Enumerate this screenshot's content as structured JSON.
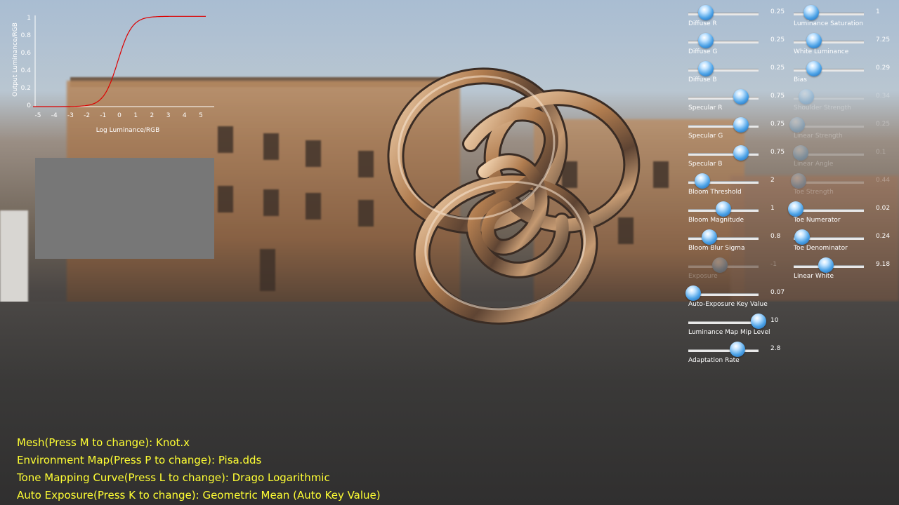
{
  "graph": {
    "ylabel": "Output Luminance/RGB",
    "xlabel": "Log Luminance/RGB",
    "y_ticks": [
      "1",
      "0.8",
      "0.6",
      "0.4",
      "0.2",
      "0"
    ],
    "x_ticks": [
      "-5",
      "-4",
      "-3",
      "-2",
      "-1",
      "0",
      "1",
      "2",
      "3",
      "4",
      "5"
    ],
    "curve_color": "#dd0000"
  },
  "sliders_left": [
    {
      "label": "Diffuse R",
      "value": "0.25",
      "level": 0.25,
      "enabled": true
    },
    {
      "label": "Diffuse G",
      "value": "0.25",
      "level": 0.25,
      "enabled": true
    },
    {
      "label": "Diffuse B",
      "value": "0.25",
      "level": 0.25,
      "enabled": true
    },
    {
      "label": "Specular R",
      "value": "0.75",
      "level": 0.75,
      "enabled": true
    },
    {
      "label": "Specular G",
      "value": "0.75",
      "level": 0.75,
      "enabled": true
    },
    {
      "label": "Specular B",
      "value": "0.75",
      "level": 0.75,
      "enabled": true
    },
    {
      "label": "Bloom Threshold",
      "value": "2",
      "level": 0.2,
      "enabled": true
    },
    {
      "label": "Bloom Magnitude",
      "value": "1",
      "level": 0.5,
      "enabled": true
    },
    {
      "label": "Bloom Blur Sigma",
      "value": "0.8",
      "level": 0.3,
      "enabled": true
    },
    {
      "label": "Exposure",
      "value": "-1",
      "level": 0.45,
      "enabled": false
    },
    {
      "label": "Auto-Exposure Key Value",
      "value": "0.07",
      "level": 0.07,
      "enabled": true
    },
    {
      "label": "Luminance Map Mip Level",
      "value": "10",
      "level": 1.0,
      "enabled": true
    },
    {
      "label": "Adaptation Rate",
      "value": "2.8",
      "level": 0.7,
      "enabled": true
    }
  ],
  "sliders_right": [
    {
      "label": "Luminance Saturation",
      "value": "1",
      "level": 0.25,
      "enabled": true
    },
    {
      "label": "White Luminance",
      "value": "7.25",
      "level": 0.29,
      "enabled": true
    },
    {
      "label": "Bias",
      "value": "0.29",
      "level": 0.29,
      "enabled": true
    },
    {
      "label": "Shoulder Strength",
      "value": "0.34",
      "level": 0.18,
      "enabled": false
    },
    {
      "label": "Linear Strength",
      "value": "0.25",
      "level": 0.05,
      "enabled": false
    },
    {
      "label": "Linear Angle",
      "value": "0.1",
      "level": 0.1,
      "enabled": false
    },
    {
      "label": "Toe Strength",
      "value": "0.44",
      "level": 0.07,
      "enabled": false
    },
    {
      "label": "Toe Numerator",
      "value": "0.02",
      "level": 0.03,
      "enabled": true
    },
    {
      "label": "Toe Denominator",
      "value": "0.24",
      "level": 0.12,
      "enabled": true
    },
    {
      "label": "Linear White",
      "value": "9.18",
      "level": 0.46,
      "enabled": true
    }
  ],
  "status": {
    "mesh": "Mesh(Press M to change): Knot.x",
    "env_map": "Environment Map(Press P to change): Pisa.dds",
    "tone_curve": "Tone Mapping Curve(Press L to change): Drago Logarithmic",
    "auto_exposure": "Auto Exposure(Press K to change): Geometric Mean (Auto Key Value)"
  },
  "colors": {
    "status_text": "#ffff33",
    "slider_thumb": "#4aa1e6"
  }
}
